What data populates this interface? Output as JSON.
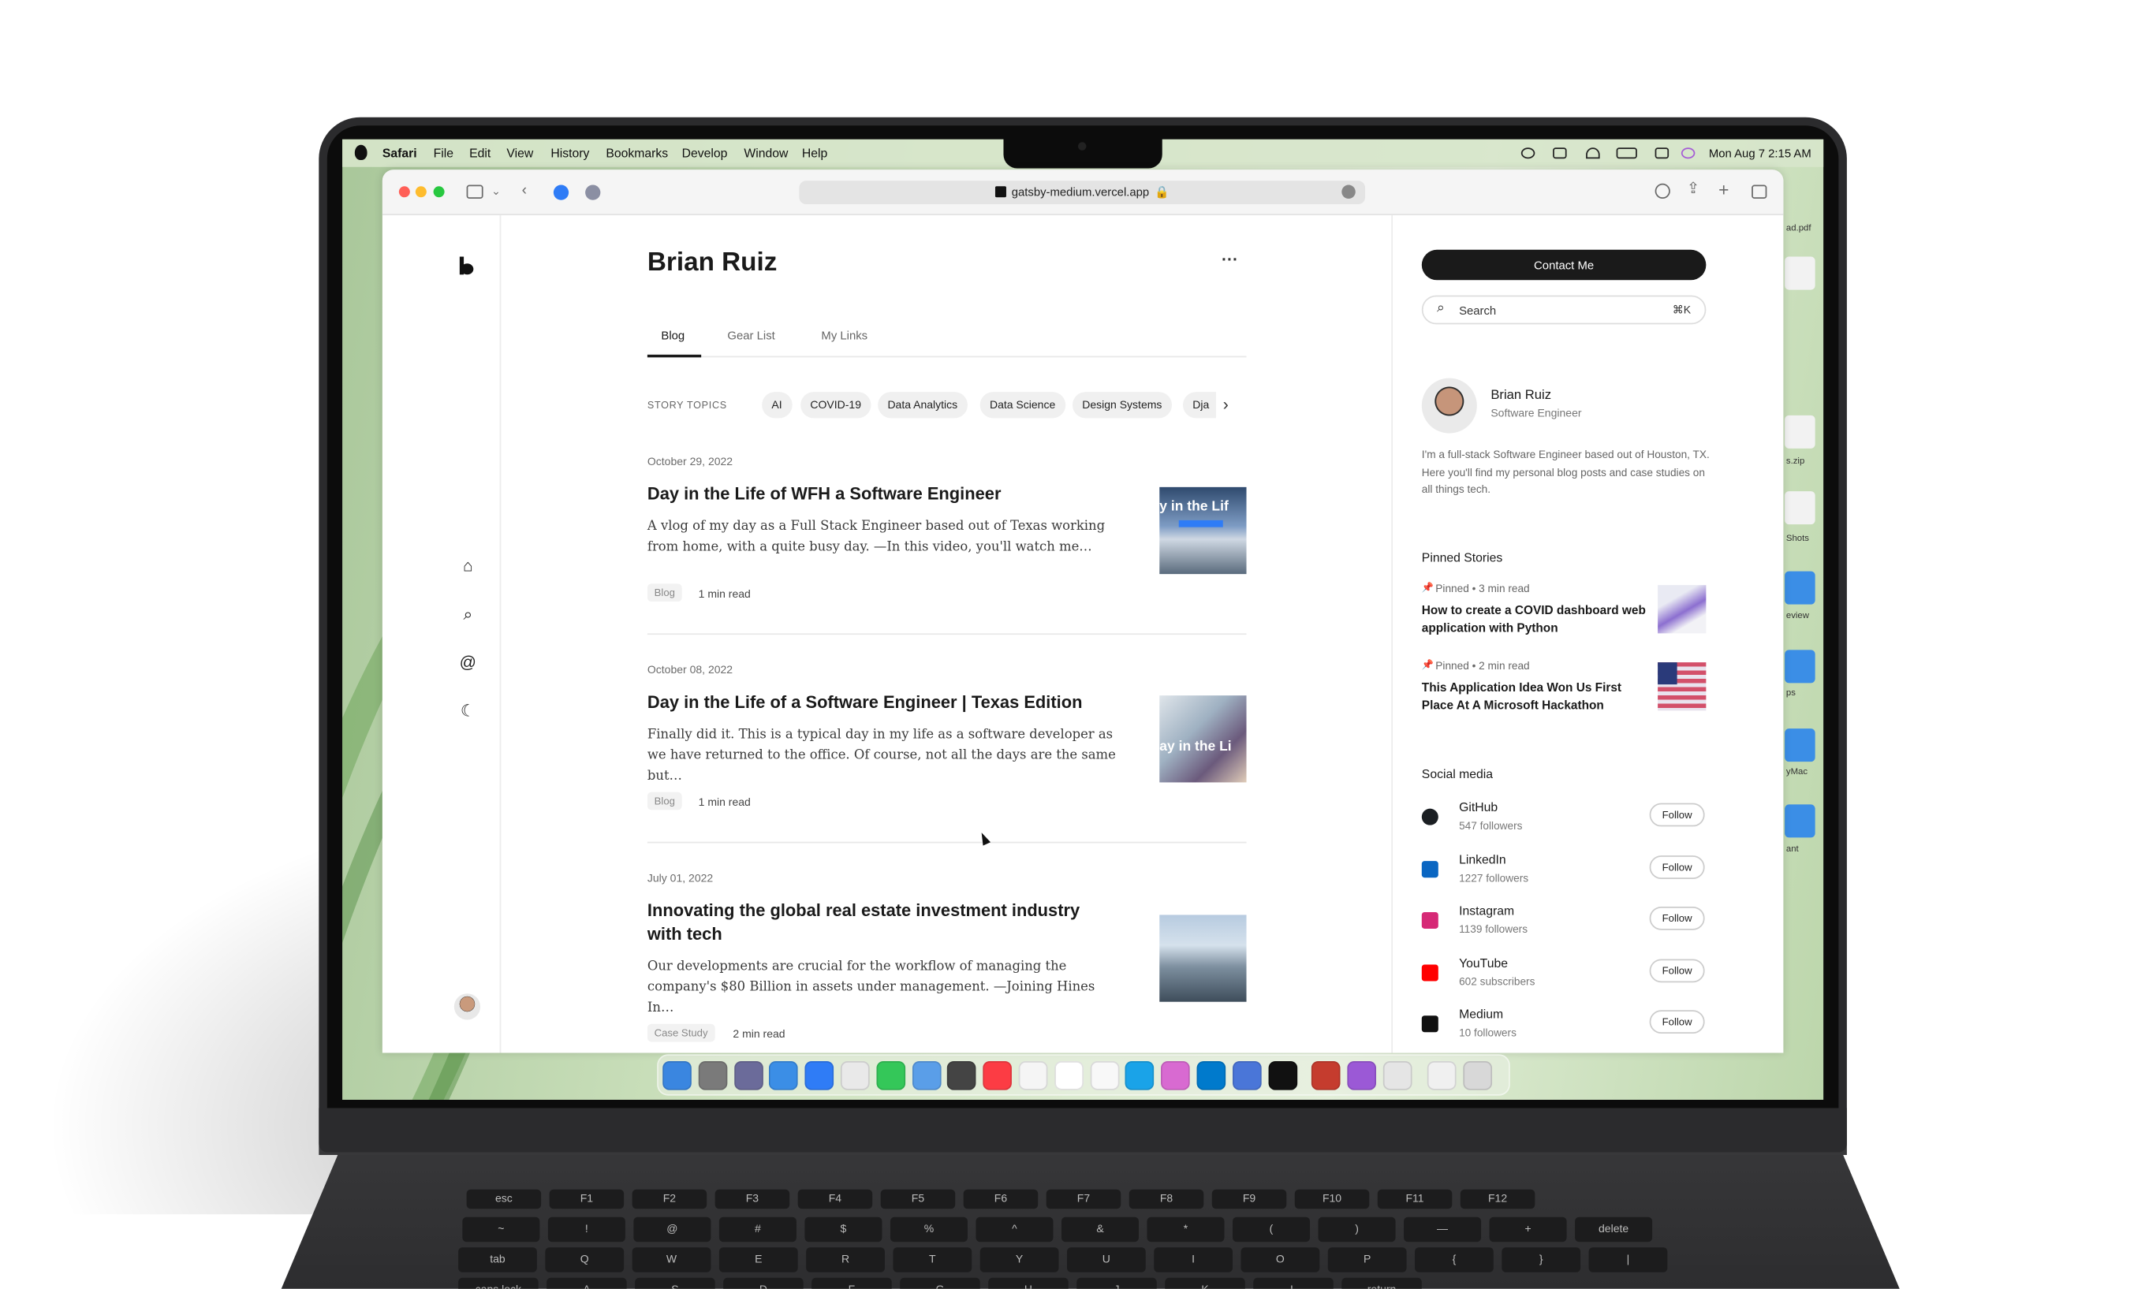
{
  "menubar": {
    "app": "Safari",
    "menus": [
      "File",
      "Edit",
      "View",
      "History",
      "Bookmarks",
      "Develop",
      "Window",
      "Help"
    ],
    "clock": "Mon Aug 7  2:15 AM"
  },
  "desktop_labels": [
    "ad.pdf",
    "s.zip",
    "Shots",
    "eview",
    "ps",
    "yMac",
    "ant"
  ],
  "browser": {
    "url": "gatsby-medium.vercel.app"
  },
  "profile": {
    "name": "Brian Ruiz",
    "more": "···",
    "tabs": [
      "Blog",
      "Gear List",
      "My Links"
    ],
    "topics_label": "STORY TOPICS",
    "topics": [
      "AI",
      "COVID-19",
      "Data Analytics",
      "Data Science",
      "Design Systems",
      "Dja"
    ]
  },
  "posts": [
    {
      "date": "October 29, 2022",
      "title": "Day in the Life of WFH a Software Engineer",
      "desc": "A vlog of my day as a Full Stack Engineer based out of Texas working from home, with a quite busy day. —In this video, you'll watch me…",
      "tag": "Blog",
      "read": "1 min read",
      "thumb_text": "y in the Lif"
    },
    {
      "date": "October 08, 2022",
      "title": "Day in the Life of a Software Engineer | Texas Edition",
      "desc": "Finally did it. This is a typical day in my life as a software developer as we have returned to the office. Of course, not all the days are the same but…",
      "tag": "Blog",
      "read": "1 min read",
      "thumb_text": "ay in the Li"
    },
    {
      "date": "July 01, 2022",
      "title": "Innovating the global real estate investment industry with tech",
      "desc": "Our developments are crucial for the workflow of managing the company's $80 Billion in assets under management. —Joining Hines In…",
      "tag": "Case Study",
      "read": "2 min read",
      "thumb_text": ""
    }
  ],
  "sidebar": {
    "contact_label": "Contact Me",
    "search_label": "Search",
    "search_shortcut": "⌘K",
    "name": "Brian Ruiz",
    "role": "Software Engineer",
    "bio": "I'm a full-stack Software Engineer based out of Houston, TX. Here you'll find my personal blog posts and case studies on all things tech.",
    "pinned_heading": "Pinned Stories",
    "pinned": [
      {
        "meta": "Pinned • 3 min read",
        "title": "How to create a COVID dashboard web application with Python"
      },
      {
        "meta": "Pinned • 2 min read",
        "title": "This Application Idea Won Us First Place At A Microsoft Hackathon"
      }
    ],
    "social_heading": "Social media",
    "follow_label": "Follow",
    "social": [
      {
        "name": "GitHub",
        "count": "547 followers",
        "color": "#1b1f23"
      },
      {
        "name": "LinkedIn",
        "count": "1227 followers",
        "color": "#0a66c2"
      },
      {
        "name": "Instagram",
        "count": "1139 followers",
        "color": "#d62976"
      },
      {
        "name": "YouTube",
        "count": "602 subscribers",
        "color": "#ff0000"
      },
      {
        "name": "Medium",
        "count": "10 followers",
        "color": "#111111"
      }
    ]
  },
  "keyboard": {
    "row_fn": [
      "esc",
      "F1",
      "F2",
      "F3",
      "F4",
      "F5",
      "F6",
      "F7",
      "F8",
      "F9",
      "F10",
      "F11",
      "F12"
    ],
    "row_num": [
      "~",
      "!",
      "@",
      "#",
      "$",
      "%",
      "^",
      "&",
      "*",
      "(",
      ")",
      "—",
      "+",
      "delete"
    ],
    "row_q": [
      "tab",
      "Q",
      "W",
      "E",
      "R",
      "T",
      "Y",
      "U",
      "I",
      "O",
      "P",
      "{",
      "}",
      "|"
    ],
    "row_a": [
      "caps lock",
      "A",
      "S",
      "D",
      "F",
      "G",
      "H",
      "J",
      "K",
      "L",
      "return"
    ]
  }
}
